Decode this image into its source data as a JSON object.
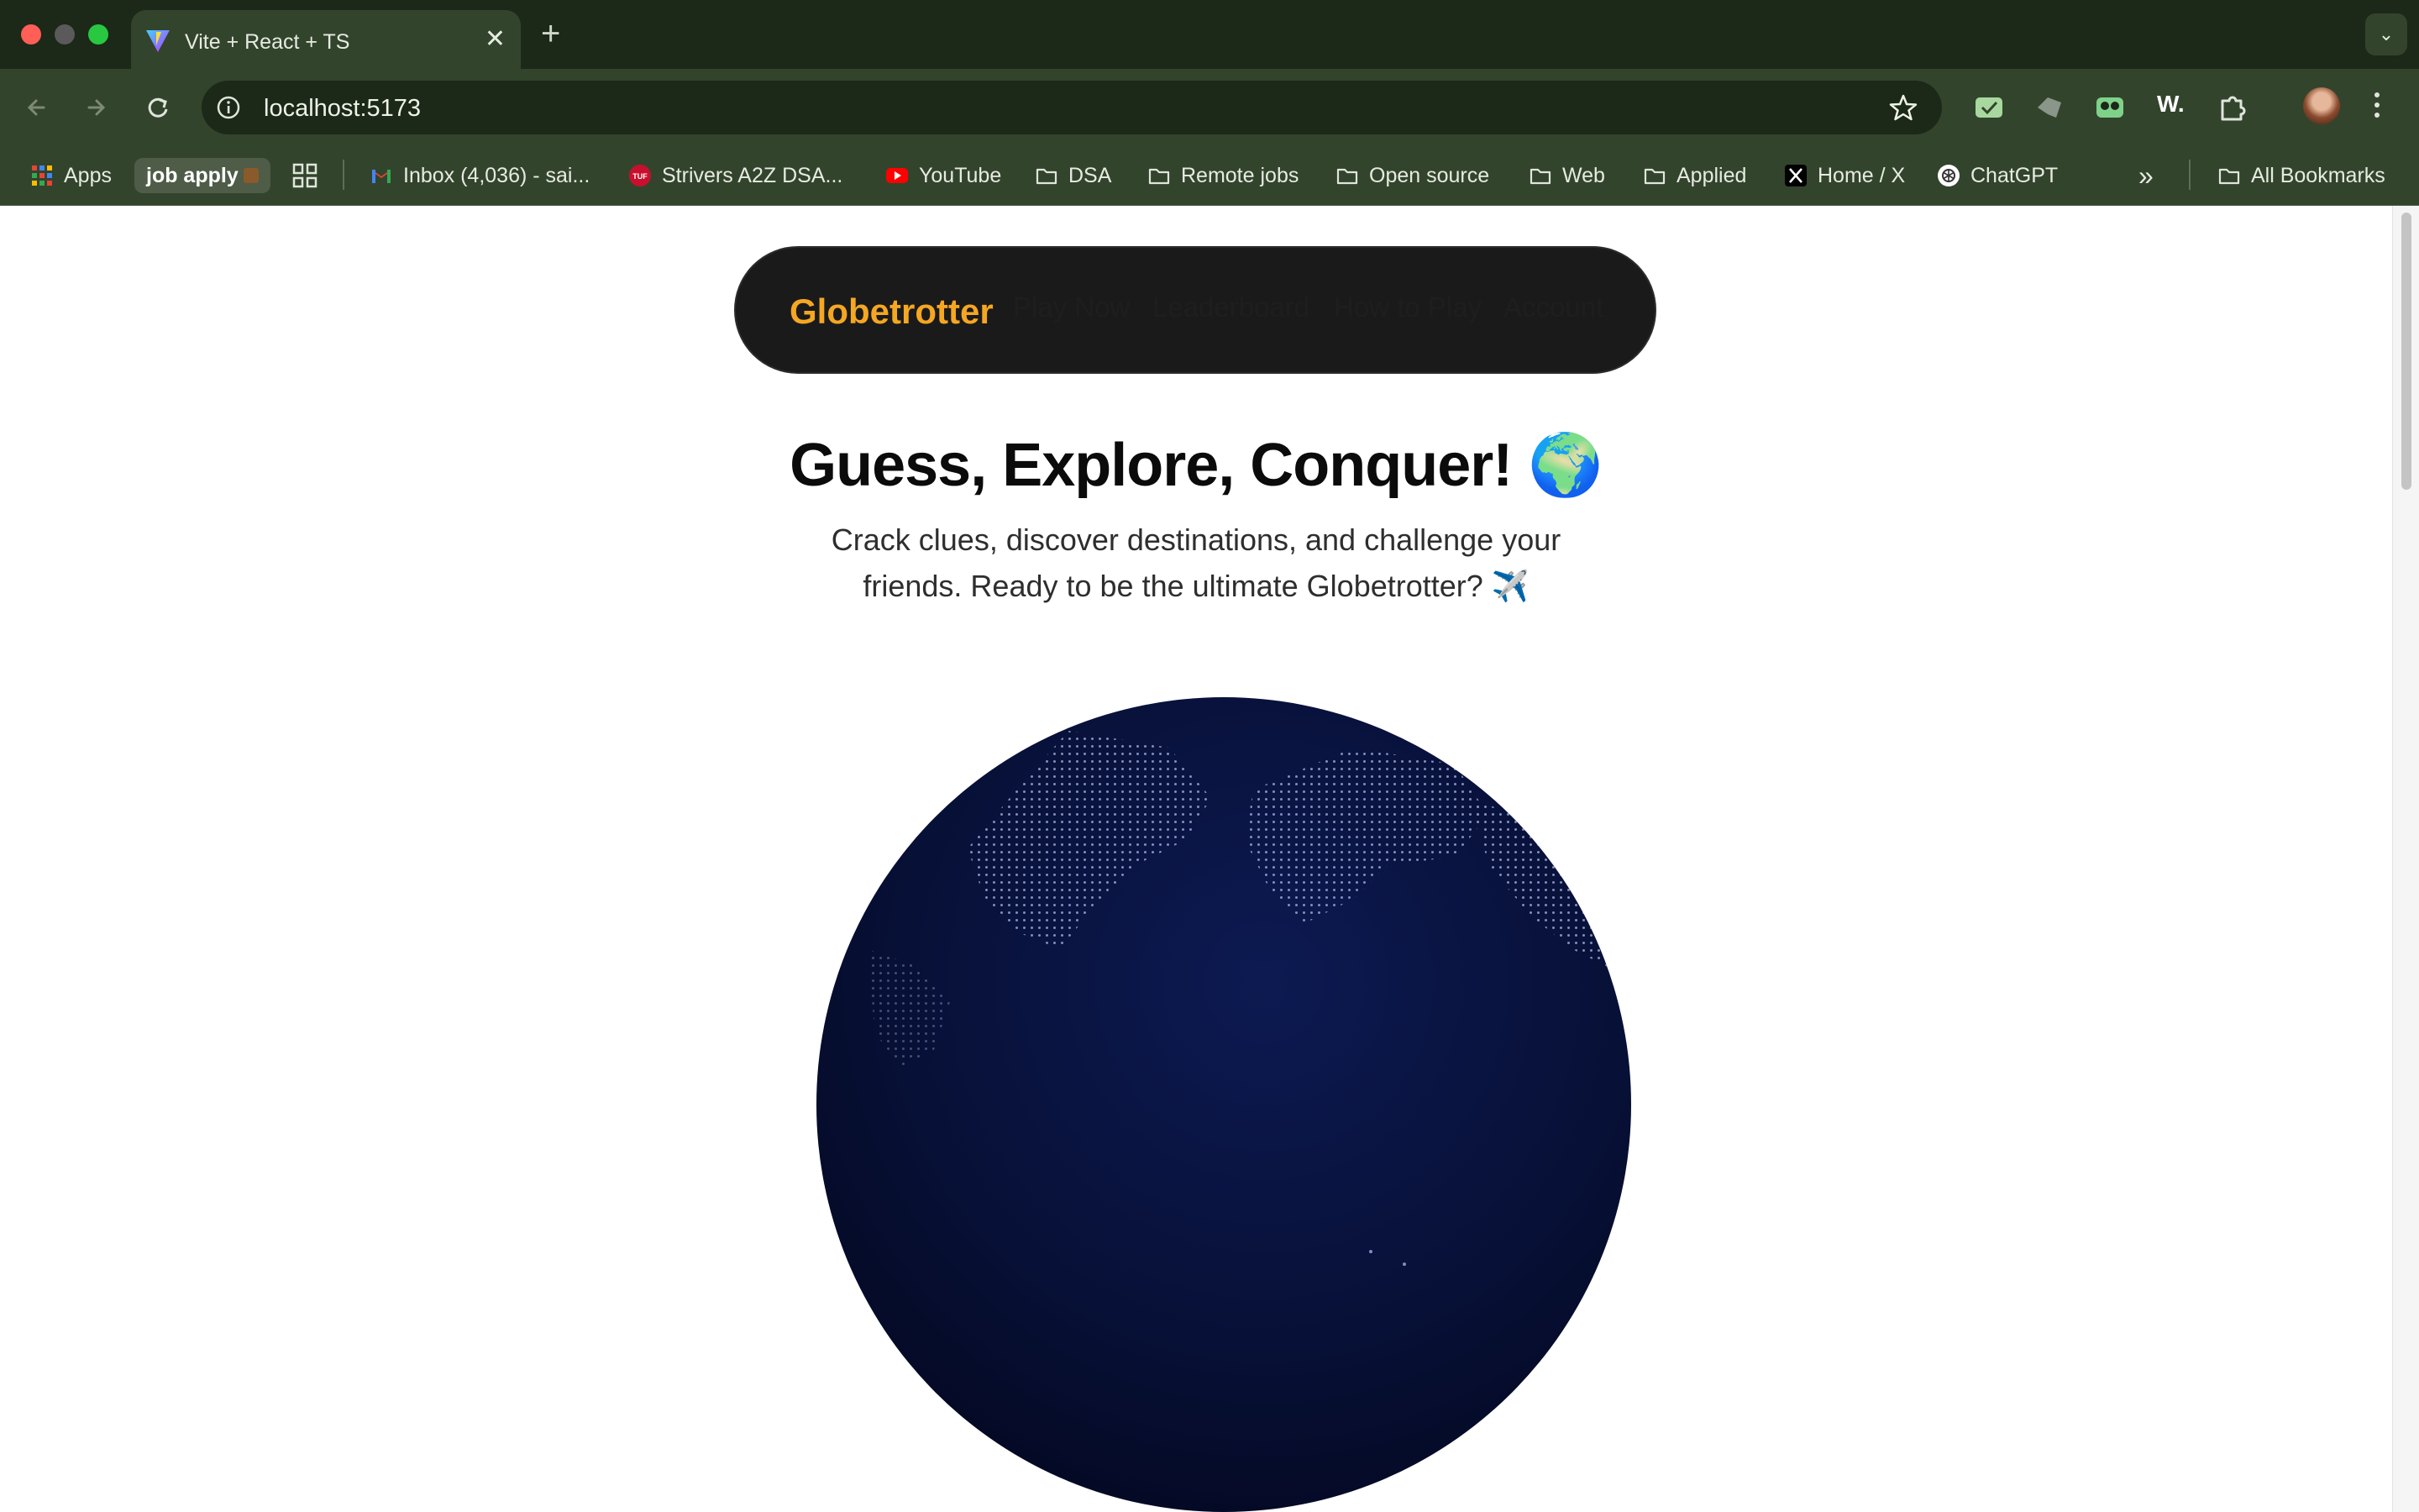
{
  "browser": {
    "tab": {
      "title": "Vite + React + TS",
      "close": "✕"
    },
    "new_tab": "+",
    "tab_menu": "⌄",
    "address": {
      "url": "localhost:5173"
    },
    "extension_w": "W.",
    "bookmarks": [
      {
        "label": "Apps",
        "icon": "apps-grid-icon"
      },
      {
        "label": "job apply",
        "icon": "box-emoji"
      },
      {
        "label": "Inbox (4,036) - sai...",
        "icon": "gmail-icon"
      },
      {
        "label": "Strivers A2Z DSA...",
        "icon": "tuf-icon"
      },
      {
        "label": "YouTube",
        "icon": "youtube-icon"
      },
      {
        "label": "DSA",
        "icon": "folder-icon"
      },
      {
        "label": "Remote jobs",
        "icon": "folder-icon"
      },
      {
        "label": "Open source",
        "icon": "folder-icon"
      },
      {
        "label": "Web",
        "icon": "folder-icon"
      },
      {
        "label": "Applied",
        "icon": "folder-icon"
      },
      {
        "label": "Home / X",
        "icon": "x-icon"
      },
      {
        "label": "ChatGPT",
        "icon": "chatgpt-icon"
      }
    ],
    "overflow": "»",
    "all_bookmarks": "All Bookmarks"
  },
  "navbar": {
    "brand": "Globetrotter",
    "links": [
      "Play Now",
      "Leaderboard",
      "How to Play",
      "Account"
    ]
  },
  "hero": {
    "title": "Guess, Explore, Conquer! 🌍",
    "subtitle_line1": "Crack clues, discover destinations, and challenge your",
    "subtitle_line2": "friends. Ready to be the ultimate Globetrotter? ✈️"
  },
  "colors": {
    "brand": "#f5a623",
    "globe": "#050a2a",
    "chrome_dark": "#1c2818",
    "chrome_light": "#33442c"
  }
}
